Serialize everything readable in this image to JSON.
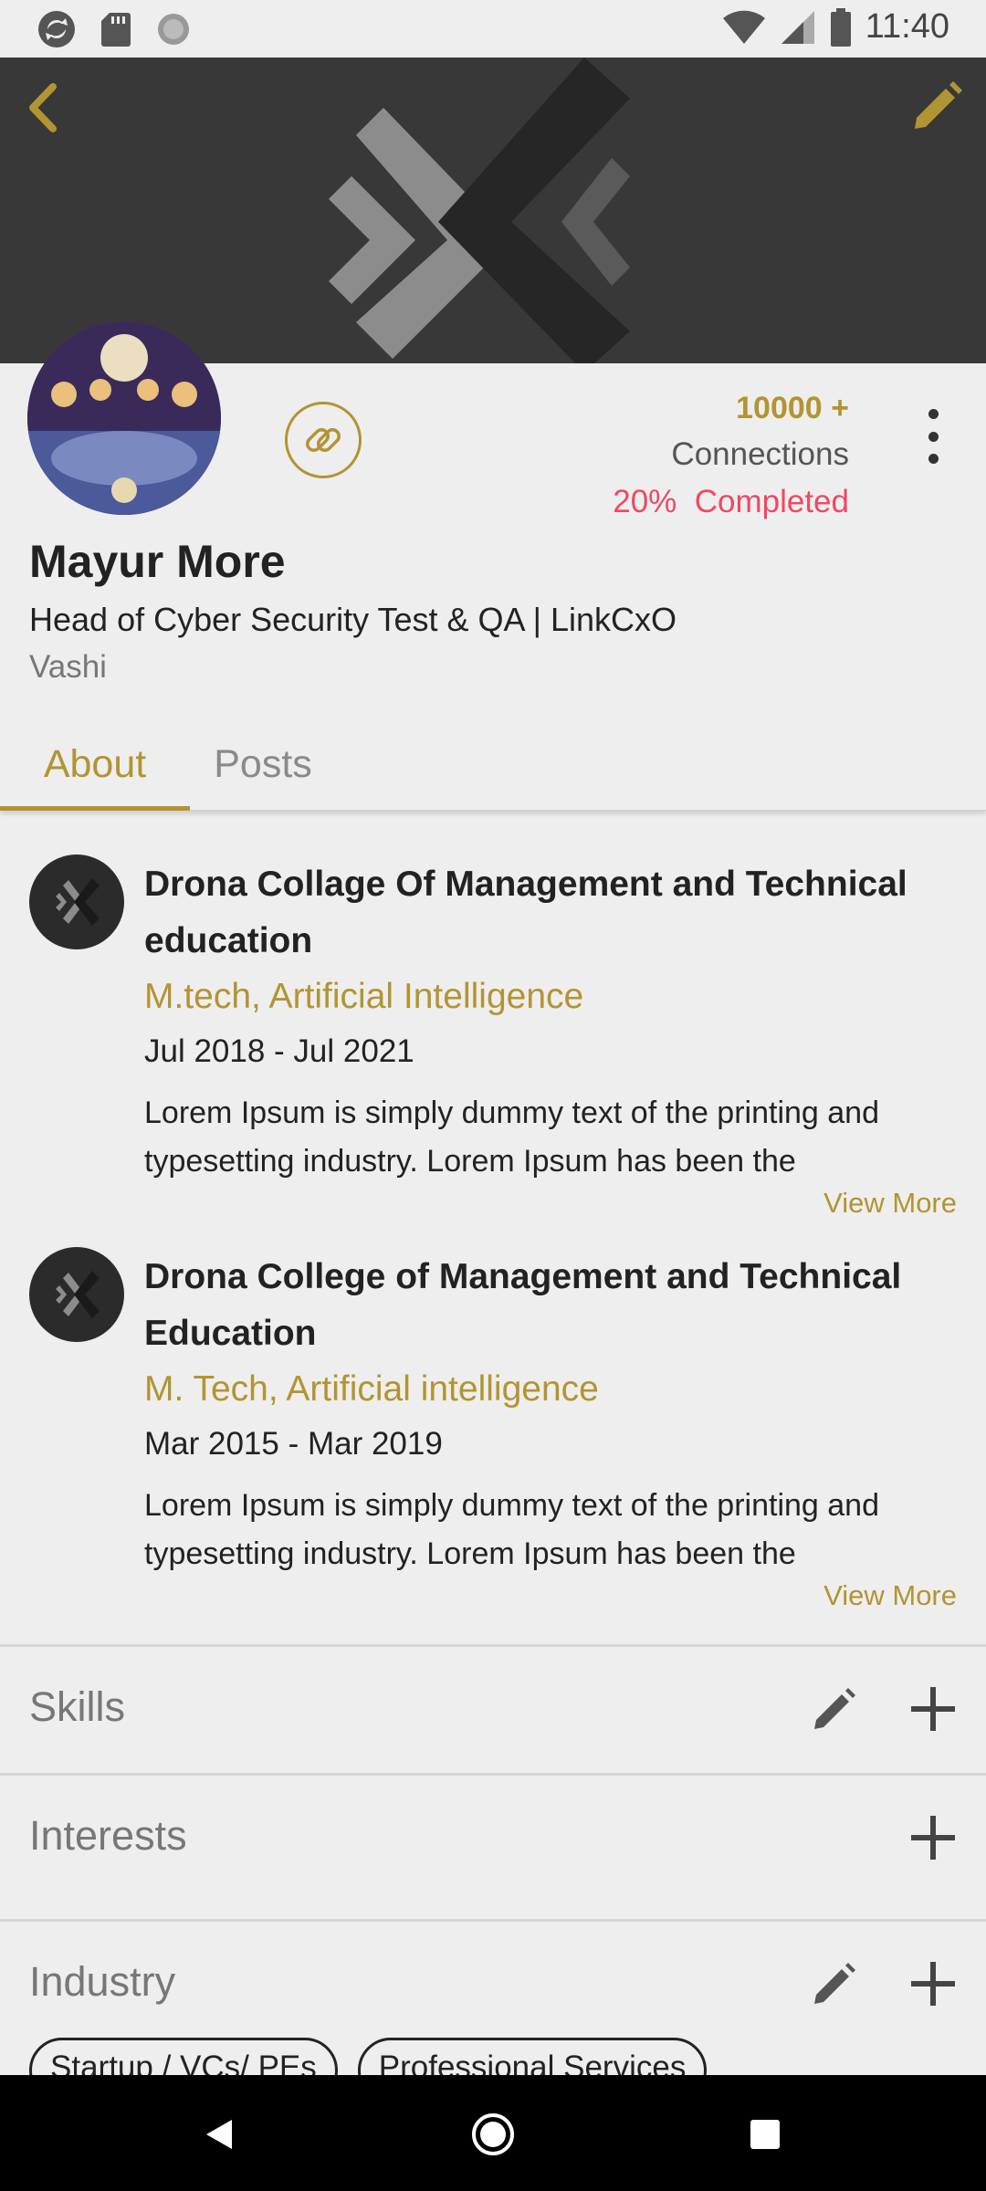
{
  "status_bar": {
    "time": "11:40",
    "icons": [
      "sync-icon",
      "sd-card-icon",
      "loading-icon",
      "wifi-icon",
      "signal-icon",
      "battery-icon"
    ]
  },
  "cover": {
    "back_icon": "chevron-left-icon",
    "edit_icon": "pencil-icon"
  },
  "profile": {
    "connections_count": "10000 +",
    "connections_label": "Connections",
    "completed": "20%  Completed",
    "name": "Mayur More",
    "headline": "Head of Cyber Security Test & QA | LinkCxO",
    "location": "Vashi"
  },
  "tabs": [
    {
      "label": "About",
      "active": true
    },
    {
      "label": "Posts",
      "active": false
    }
  ],
  "education": [
    {
      "school": "Drona Collage Of Management and Technical education",
      "degree": "M.tech, Artificial Intelligence",
      "dates": "Jul 2018 - Jul 2021",
      "description": "Lorem Ipsum is simply dummy text of the printing and typesetting industry. Lorem Ipsum has been the",
      "view_more": "View More"
    },
    {
      "school": "Drona College of Management and Technical Education",
      "degree": "M. Tech, Artificial intelligence",
      "dates": "Mar 2015 - Mar 2019",
      "description": "Lorem Ipsum is simply dummy text of the printing and typesetting industry. Lorem Ipsum has been the",
      "view_more": "View More"
    }
  ],
  "sections": {
    "skills": "Skills",
    "interests": "Interests",
    "industry": "Industry"
  },
  "industry_chips": [
    "Startup / VCs/ PEs",
    "Professional Services"
  ],
  "colors": {
    "accent": "#b29432",
    "alert": "#ef4864",
    "cover": "#383838",
    "background": "#eeeeee"
  }
}
